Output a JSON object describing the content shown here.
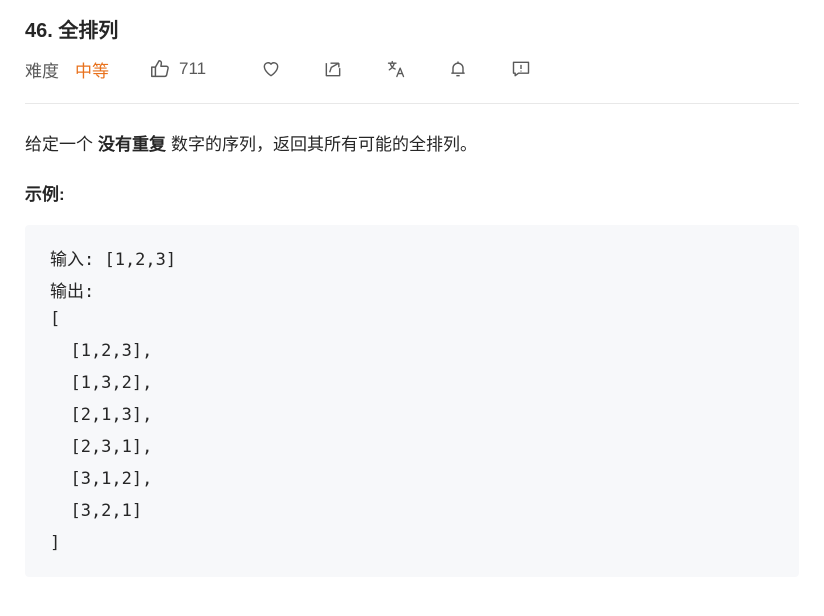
{
  "problem": {
    "title": "46. 全排列",
    "difficulty_label": "难度",
    "difficulty": "中等",
    "likes": "711"
  },
  "toolbar": {
    "icons": [
      "thumbs-up-icon",
      "heart-icon",
      "share-icon",
      "translate-icon",
      "bell-icon",
      "feedback-icon"
    ]
  },
  "description": {
    "before": "给定一个",
    "bold": "没有重复",
    "after": "数字的序列，返回其所有可能的全排列。"
  },
  "example": {
    "title": "示例:",
    "lines": [
      "输入: [1,2,3]",
      "输出:",
      "[",
      "  [1,2,3],",
      "  [1,3,2],",
      "  [2,1,3],",
      "  [2,3,1],",
      "  [3,1,2],",
      "  [3,2,1]",
      "]"
    ]
  },
  "colors": {
    "difficulty_medium": "#e8711c",
    "code_background": "#f7f8fa",
    "divider": "#e8e8e8"
  }
}
